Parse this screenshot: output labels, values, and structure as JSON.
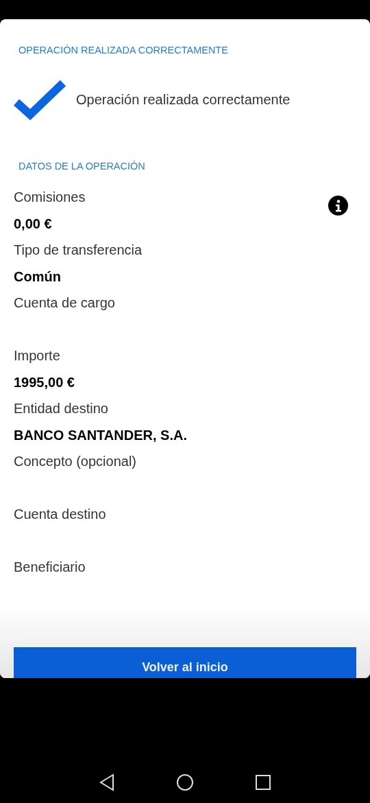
{
  "header": {
    "title": "OPERACIÓN REALIZADA CORRECTAMENTE"
  },
  "status": {
    "message": "Operación realizada correctamente"
  },
  "section": {
    "title": "DATOS DE LA OPERACIÓN"
  },
  "fields": [
    {
      "label": "Comisiones",
      "value": "0,00 €",
      "info": true
    },
    {
      "label": "Tipo de transferencia",
      "value": "Común",
      "info": false
    },
    {
      "label": "Cuenta de cargo",
      "info": false
    },
    {
      "label": "Importe",
      "value": "1995,00 €",
      "info": false
    },
    {
      "label": "Entidad destino",
      "value": "BANCO SANTANDER, S.A.",
      "info": false
    },
    {
      "label": "Concepto (opcional)",
      "info": false
    },
    {
      "label": "Cuenta destino",
      "info": false
    },
    {
      "label": "Beneficiario",
      "info": false
    }
  ],
  "button": {
    "label": "Volver al inicio"
  }
}
